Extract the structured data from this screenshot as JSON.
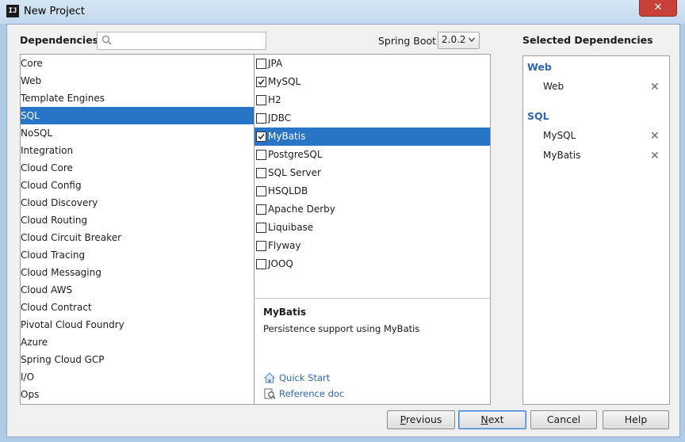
{
  "window": {
    "title": "New Project",
    "app_icon": "intellij-icon",
    "close_symbol": "✕"
  },
  "header": {
    "dependencies_label": "Dependencies",
    "search": {
      "value": "",
      "placeholder": ""
    },
    "spring_boot_label": "Spring Boot",
    "spring_boot_version": "2.0.2",
    "selected_label": "Selected Dependencies"
  },
  "categories": {
    "selected": "SQL",
    "items": [
      "Core",
      "Web",
      "Template Engines",
      "SQL",
      "NoSQL",
      "Integration",
      "Cloud Core",
      "Cloud Config",
      "Cloud Discovery",
      "Cloud Routing",
      "Cloud Circuit Breaker",
      "Cloud Tracing",
      "Cloud Messaging",
      "Cloud AWS",
      "Cloud Contract",
      "Pivotal Cloud Foundry",
      "Azure",
      "Spring Cloud GCP",
      "I/O",
      "Ops"
    ]
  },
  "dependencies": {
    "highlighted": "MyBatis",
    "items": [
      {
        "label": "JPA",
        "checked": false
      },
      {
        "label": "MySQL",
        "checked": true
      },
      {
        "label": "H2",
        "checked": false
      },
      {
        "label": "JDBC",
        "checked": false
      },
      {
        "label": "MyBatis",
        "checked": true
      },
      {
        "label": "PostgreSQL",
        "checked": false
      },
      {
        "label": "SQL Server",
        "checked": false
      },
      {
        "label": "HSQLDB",
        "checked": false
      },
      {
        "label": "Apache Derby",
        "checked": false
      },
      {
        "label": "Liquibase",
        "checked": false
      },
      {
        "label": "Flyway",
        "checked": false
      },
      {
        "label": "JOOQ",
        "checked": false
      }
    ]
  },
  "description": {
    "title": "MyBatis",
    "text": "Persistence support using MyBatis",
    "links": [
      {
        "label": "Quick Start",
        "icon": "home-icon"
      },
      {
        "label": "Reference doc",
        "icon": "reference-doc-icon"
      }
    ]
  },
  "selected_dependencies": {
    "groups": [
      {
        "name": "Web",
        "items": [
          "Web"
        ]
      },
      {
        "name": "SQL",
        "items": [
          "MySQL",
          "MyBatis"
        ]
      }
    ],
    "remove_symbol": "✕"
  },
  "buttons": {
    "previous": {
      "label": "Previous",
      "mnemonic": "P"
    },
    "next": {
      "label": "Next",
      "mnemonic": "N"
    },
    "cancel": {
      "label": "Cancel"
    },
    "help": {
      "label": "Help"
    }
  },
  "colors": {
    "selection": "#2874c6",
    "link": "#2c67b5",
    "close": "#c7413a"
  }
}
